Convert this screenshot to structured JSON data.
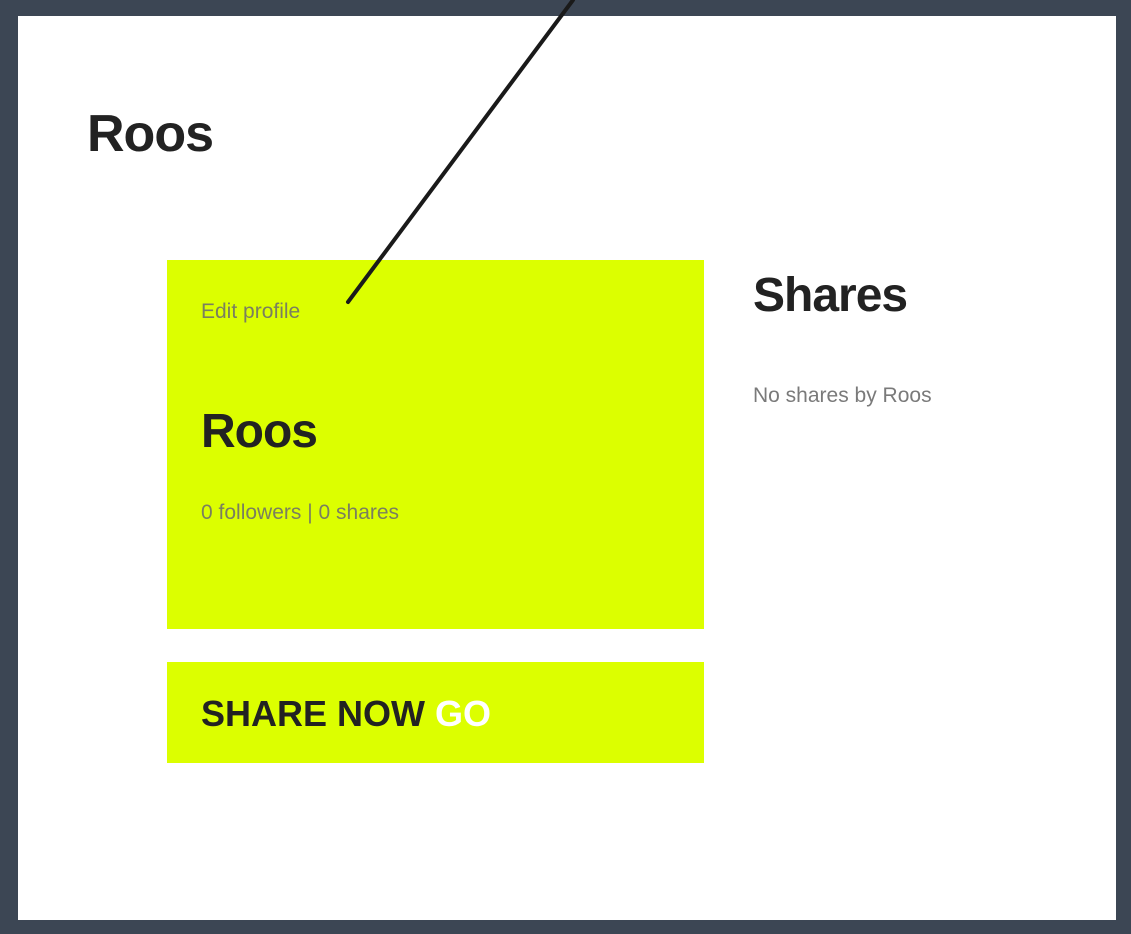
{
  "page": {
    "title": "Roos"
  },
  "profile_card": {
    "edit_label": "Edit profile",
    "name": "Roos",
    "stats": "0 followers | 0 shares"
  },
  "share_bar": {
    "label": "SHARE NOW",
    "go_label": "GO"
  },
  "shares": {
    "heading": "Shares",
    "empty_message": "No shares by Roos"
  },
  "colors": {
    "frame_border": "#3c4654",
    "accent": "#dcff00",
    "text_dark": "#222222",
    "text_muted": "#7a7a7a"
  }
}
